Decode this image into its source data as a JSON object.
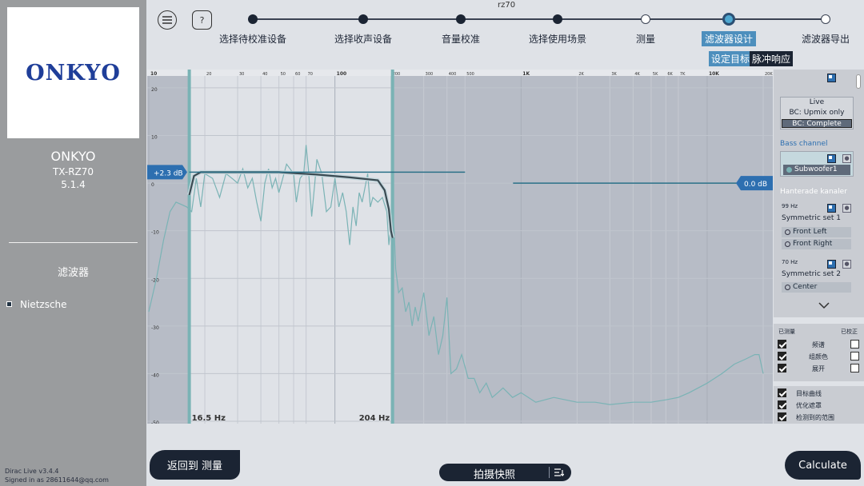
{
  "sidebar": {
    "logo_text": "ONKYO",
    "device_name": "ONKYO",
    "device_model": "TX-RZ70",
    "channel_config": "5.1.4",
    "filters_title": "滤波器",
    "filter_item": "Nietzsche",
    "version": "Dirac Live v3.4.4",
    "signed_in": "Signed in as 28611644@qq.com"
  },
  "header": {
    "menu_icon": "menu-icon",
    "help_label": "?",
    "project_name": "rz70"
  },
  "steps": [
    {
      "label": "选择待校准设备",
      "state": "done"
    },
    {
      "label": "选择收声设备",
      "state": "done"
    },
    {
      "label": "音量校准",
      "state": "done"
    },
    {
      "label": "选择使用场景",
      "state": "done"
    },
    {
      "label": "测量",
      "state": "open"
    },
    {
      "label": "滤波器设计",
      "state": "current"
    },
    {
      "label": "滤波器导出",
      "state": "open"
    }
  ],
  "subtabs": {
    "target": "设定目标",
    "impulse": "脉冲响应"
  },
  "chart_data": {
    "type": "line",
    "x_scale": "log",
    "xlim": [
      10,
      20000
    ],
    "ylim": [
      -50,
      22
    ],
    "x_ticks": [
      "10",
      "20",
      "30",
      "40",
      "50",
      "60",
      "70",
      "100",
      "200",
      "300",
      "400",
      "500",
      "1K",
      "2K",
      "3K",
      "4K",
      "5K",
      "6K",
      "7K",
      "10K",
      "20K"
    ],
    "y_ticks": [
      "20",
      "10",
      "0",
      "-10",
      "-20",
      "-30",
      "-40",
      "-50"
    ],
    "left_gain_label": "+2.3 dB",
    "right_gain_label": "0.0 dB",
    "low_cutoff_label": "16.5 Hz",
    "high_cutoff_label": "204 Hz",
    "series": [
      {
        "color": "#7ab3b5",
        "points": [
          [
            10,
            -27
          ],
          [
            11,
            -20
          ],
          [
            12,
            -12
          ],
          [
            13,
            -6
          ],
          [
            14,
            -4
          ],
          [
            15,
            -4.5
          ],
          [
            16,
            -5
          ],
          [
            17,
            -6
          ],
          [
            18,
            1
          ],
          [
            19,
            -5
          ],
          [
            20,
            2
          ],
          [
            22,
            1
          ],
          [
            24,
            -3
          ],
          [
            26,
            2
          ],
          [
            28,
            1
          ],
          [
            30,
            0
          ],
          [
            32,
            3
          ],
          [
            34,
            -1
          ],
          [
            36,
            1
          ],
          [
            38,
            -4
          ],
          [
            40,
            -8
          ],
          [
            42,
            0
          ],
          [
            44,
            3
          ],
          [
            46,
            -1
          ],
          [
            48,
            1
          ],
          [
            50,
            -2
          ],
          [
            55,
            4
          ],
          [
            60,
            2
          ],
          [
            62,
            -4
          ],
          [
            65,
            1
          ],
          [
            68,
            2
          ],
          [
            70,
            8
          ],
          [
            72,
            3
          ],
          [
            75,
            -7
          ],
          [
            78,
            0
          ],
          [
            80,
            5
          ],
          [
            85,
            2
          ],
          [
            90,
            -6
          ],
          [
            95,
            -5
          ],
          [
            100,
            1
          ],
          [
            105,
            -5
          ],
          [
            110,
            -2
          ],
          [
            115,
            -6
          ],
          [
            120,
            -13
          ],
          [
            125,
            -5
          ],
          [
            130,
            -9
          ],
          [
            135,
            -2
          ],
          [
            140,
            -4
          ],
          [
            150,
            2
          ],
          [
            155,
            -5
          ],
          [
            160,
            -3
          ],
          [
            170,
            -4
          ],
          [
            180,
            -3
          ],
          [
            190,
            -6
          ],
          [
            195,
            -13
          ],
          [
            200,
            -9
          ],
          [
            204,
            -5
          ],
          [
            208,
            -10
          ],
          [
            212,
            -18
          ],
          [
            220,
            -23
          ],
          [
            230,
            -22
          ],
          [
            240,
            -27
          ],
          [
            250,
            -25
          ],
          [
            260,
            -30
          ],
          [
            270,
            -26
          ],
          [
            280,
            -29
          ],
          [
            300,
            -23
          ],
          [
            320,
            -32
          ],
          [
            340,
            -28
          ],
          [
            360,
            -36
          ],
          [
            380,
            -32
          ],
          [
            400,
            -24
          ],
          [
            420,
            -40
          ],
          [
            450,
            -39
          ],
          [
            480,
            -36
          ],
          [
            520,
            -41
          ],
          [
            560,
            -41
          ],
          [
            600,
            -44
          ],
          [
            650,
            -42
          ],
          [
            700,
            -45
          ],
          [
            750,
            -44
          ],
          [
            800,
            -43
          ],
          [
            900,
            -45
          ],
          [
            1000,
            -44
          ],
          [
            1200,
            -46
          ],
          [
            1500,
            -45
          ],
          [
            2000,
            -46
          ],
          [
            2500,
            -46
          ],
          [
            3000,
            -46.5
          ],
          [
            4000,
            -46
          ],
          [
            5000,
            -46
          ],
          [
            6000,
            -45.5
          ],
          [
            7000,
            -45
          ],
          [
            8000,
            -44
          ],
          [
            10000,
            -42
          ],
          [
            12000,
            -40
          ],
          [
            14000,
            -38
          ],
          [
            16000,
            -37
          ],
          [
            18000,
            -36
          ],
          [
            19000,
            -36
          ],
          [
            20000,
            -40
          ]
        ]
      },
      {
        "color": "#3a4a52",
        "points": [
          [
            16.5,
            -2.5
          ],
          [
            17.5,
            1.5
          ],
          [
            19,
            2.3
          ],
          [
            30,
            2.3
          ],
          [
            50,
            2.3
          ],
          [
            80,
            1.8
          ],
          [
            120,
            1.2
          ],
          [
            170,
            0.6
          ],
          [
            185,
            -1.5
          ],
          [
            195,
            -5.5
          ],
          [
            200,
            -10
          ],
          [
            204,
            -11.5
          ]
        ]
      },
      {
        "color": "#2a7088",
        "points": [
          [
            16.5,
            2.3
          ],
          [
            20,
            2.3
          ],
          [
            100,
            2.3
          ],
          [
            500,
            2.3
          ]
        ]
      }
    ]
  },
  "right_panel": {
    "mode_options": [
      "Live",
      "BC: Upmix only",
      "BC: Complete"
    ],
    "selected_mode": "BC: Complete",
    "bass_channel_title": "Bass channel",
    "bass_channel_item": "Subwoofer1",
    "handled_title": "Hanterade kanaler",
    "set1_freq": "99 Hz",
    "set1_name": "Symmetric set 1",
    "set1_items": [
      "Front Left",
      "Front Right"
    ],
    "set2_freq": "70 Hz",
    "set2_name": "Symmetric set 2",
    "set2_items": [
      "Center"
    ]
  },
  "legend_panel": {
    "measured_label": "已测量",
    "corrected_label": "已校正",
    "rows": [
      {
        "label": "频谱",
        "measured": true,
        "corrected": false
      },
      {
        "label": "组颜色",
        "measured": true,
        "corrected": false
      },
      {
        "label": "展开",
        "measured": true,
        "corrected": false
      }
    ],
    "options": [
      {
        "label": "目标曲线",
        "checked": true
      },
      {
        "label": "优化遮罩",
        "checked": true
      },
      {
        "label": "检测到的范围",
        "checked": true
      }
    ]
  },
  "footer": {
    "back_label": "返回到 测量",
    "snapshot_label": "拍摄快照",
    "calculate_label": "Calculate"
  },
  "colors": {
    "accent": "#4d8fbd",
    "dark": "#1b2433",
    "measurement": "#7ab3b5"
  }
}
